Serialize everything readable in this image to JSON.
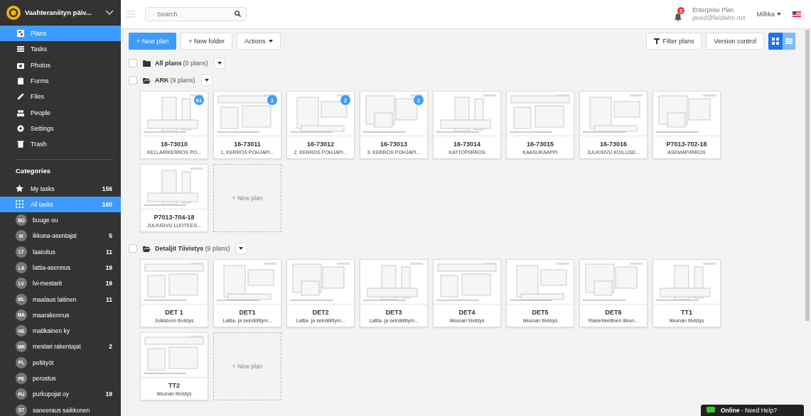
{
  "project": {
    "name": "Vaahteraniityn päiv..."
  },
  "nav": [
    {
      "label": "Plans",
      "selected": true
    },
    {
      "label": "Tasks",
      "selected": false
    },
    {
      "label": "Photos",
      "selected": false
    },
    {
      "label": "Forms",
      "selected": false
    },
    {
      "label": "Files",
      "selected": false
    },
    {
      "label": "People",
      "selected": false
    },
    {
      "label": "Settings",
      "selected": false
    },
    {
      "label": "Trash",
      "selected": false
    }
  ],
  "categories_heading": "Categories",
  "categories": [
    {
      "kind": "star",
      "label": "My tasks",
      "count": "156",
      "selected": false
    },
    {
      "kind": "grid",
      "label": "All tasks",
      "count": "160",
      "selected": true
    },
    {
      "kind": "avatar",
      "initials": "BO",
      "label": "buuge ou",
      "selected": false
    },
    {
      "kind": "avatar",
      "initials": "IK",
      "label": "ikkuna-asentajat",
      "count": "5",
      "selected": false
    },
    {
      "kind": "avatar",
      "initials": "LT",
      "label": "laatoitus",
      "count": "11",
      "selected": false
    },
    {
      "kind": "avatar",
      "initials": "LA",
      "label": "lattia-asennus",
      "count": "19",
      "selected": false
    },
    {
      "kind": "avatar",
      "initials": "LV",
      "label": "lvi-mestarit",
      "count": "19",
      "selected": false
    },
    {
      "kind": "avatar",
      "initials": "ML",
      "label": "maalaus laitinen",
      "count": "11",
      "selected": false
    },
    {
      "kind": "avatar",
      "initials": "MA",
      "label": "maarakennus",
      "selected": false
    },
    {
      "kind": "avatar",
      "initials": "HE",
      "label": "matikainen ky",
      "selected": false
    },
    {
      "kind": "avatar",
      "initials": "MR",
      "label": "mestari rakentajat",
      "count": "2",
      "selected": false
    },
    {
      "kind": "avatar",
      "initials": "PL",
      "label": "peltityöt",
      "selected": false
    },
    {
      "kind": "avatar",
      "initials": "PE",
      "label": "perustus",
      "selected": false
    },
    {
      "kind": "avatar",
      "initials": "PU",
      "label": "purkupojat oy",
      "count": "19",
      "selected": false
    },
    {
      "kind": "avatar",
      "initials": "ST",
      "label": "saneeraus saikkonen",
      "selected": false
    }
  ],
  "search": {
    "placeholder": "Search"
  },
  "account": {
    "notifications": "5",
    "plan": "Enterprise Plan",
    "email": "javed@fieldwire.net",
    "user": "Milkka"
  },
  "toolbar": {
    "new_plan": "+ New plan",
    "new_folder": "+ New folder",
    "actions": "Actions",
    "filter": "Filter plans",
    "version_control": "Version control",
    "views": [
      {
        "kind": "grid",
        "selected": true
      },
      {
        "kind": "list",
        "selected": false
      }
    ]
  },
  "folders": [
    {
      "name": "All plans",
      "count": "(0 plans)",
      "checked": false,
      "expanded": false
    },
    {
      "name": "ARK",
      "count": "(9 plans)",
      "checked": false,
      "expanded": true,
      "new_plan": "+ New plan",
      "plans": [
        {
          "number": "16-73010",
          "title": "KELLARIKERROS PO...",
          "badge": "91"
        },
        {
          "number": "16-73011",
          "title": "1. KERROS POHJAPI...",
          "badge": "1"
        },
        {
          "number": "16-73012",
          "title": "2. KERROS POHJAPI...",
          "badge": "2"
        },
        {
          "number": "16-73013",
          "title": "3. KERROS POHJAPI...",
          "badge": "2"
        },
        {
          "number": "16-73014",
          "title": "KATTOPIIRROS"
        },
        {
          "number": "16-73015",
          "title": "KAASUKAAPPI"
        },
        {
          "number": "16-73016",
          "title": "JULKISIVU KOILLISE..."
        },
        {
          "number": "P7013-702-18",
          "title": "ASEMAPIIRROS"
        },
        {
          "number": "P7013-704-18",
          "title": "JULKISIVU LUOTEES..."
        }
      ]
    },
    {
      "name": "Detaljit Tiivistys",
      "count": "(9 plans)",
      "checked": false,
      "expanded": true,
      "new_plan": "+ New plan",
      "plans": [
        {
          "number": "DET 1",
          "title": "Julkisivun tiivistys"
        },
        {
          "number": "DET1",
          "title": "Lattia- ja seinäliittym..."
        },
        {
          "number": "DET2",
          "title": "Lattia- ja seinäliittym..."
        },
        {
          "number": "DET3",
          "title": "Lattia- ja seinäliittym..."
        },
        {
          "number": "DET4",
          "title": "Ikkunan tiivistys"
        },
        {
          "number": "DET5",
          "title": "Ikkunan tiivistys"
        },
        {
          "number": "DET6",
          "title": "Rakenteellinen liikun..."
        },
        {
          "number": "TT1",
          "title": "Ikkunan tiivistys"
        },
        {
          "number": "TT2",
          "title": "Ikkunan tiivistys"
        }
      ]
    }
  ],
  "chat": {
    "text": "**Online** - Need Help?"
  }
}
